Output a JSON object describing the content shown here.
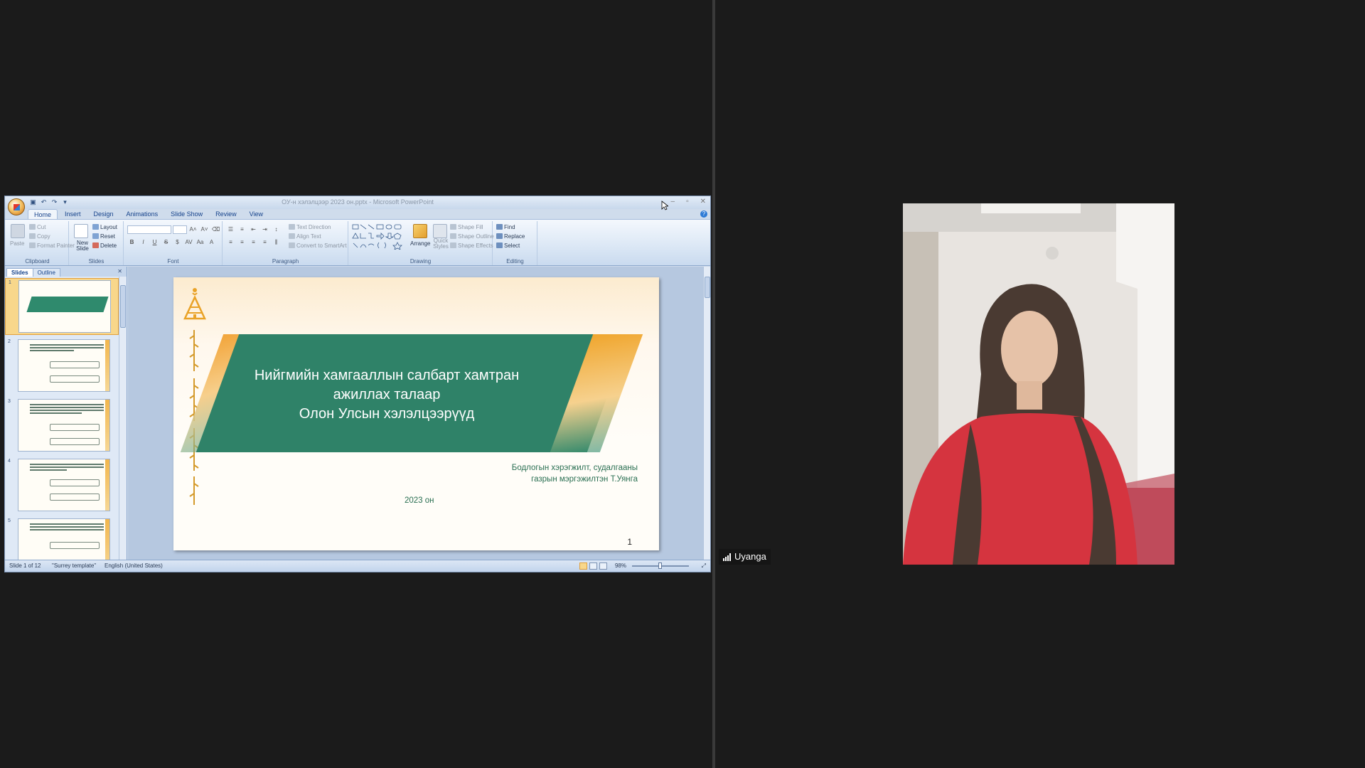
{
  "window": {
    "title": "ОУ-н хэлэлцээр 2023 он.pptx - Microsoft PowerPoint"
  },
  "ribbon": {
    "tabs": [
      "Home",
      "Insert",
      "Design",
      "Animations",
      "Slide Show",
      "Review",
      "View"
    ],
    "clipboard": {
      "paste": "Paste",
      "cut": "Cut",
      "copy": "Copy",
      "format_painter": "Format Painter",
      "label": "Clipboard"
    },
    "slides_group": {
      "new_slide": "New Slide",
      "layout": "Layout",
      "reset": "Reset",
      "delete": "Delete",
      "label": "Slides"
    },
    "font_group": {
      "label": "Font"
    },
    "paragraph_group": {
      "text_direction": "Text Direction",
      "align_text": "Align Text",
      "convert_smartart": "Convert to SmartArt",
      "label": "Paragraph"
    },
    "drawing_group": {
      "arrange": "Arrange",
      "quick_styles": "Quick Styles",
      "shape_fill": "Shape Fill",
      "shape_outline": "Shape Outline",
      "shape_effects": "Shape Effects",
      "label": "Drawing"
    },
    "editing_group": {
      "find": "Find",
      "replace": "Replace",
      "select": "Select",
      "label": "Editing"
    }
  },
  "slides_panel": {
    "tabs": [
      "Slides",
      "Outline"
    ],
    "thumb_numbers": [
      "1",
      "2",
      "3",
      "4",
      "5"
    ]
  },
  "slide": {
    "title_line1": "Нийгмийн хамгааллын салбарт хамтран",
    "title_line2": "ажиллах талаар",
    "title_line3": "Олон Улсын хэлэлцээрүүд",
    "subtitle_line1": "Бодлогын хэрэгжилт, судалгааны",
    "subtitle_line2": "газрын мэргэжилтэн Т.Уянга",
    "year": "2023 он",
    "page_number": "1"
  },
  "status": {
    "slide_of": "Slide 1 of 12",
    "template": "\"Surrey template\"",
    "language": "English (United States)",
    "zoom": "98%"
  },
  "participant": {
    "name": "Uyanga"
  },
  "colors": {
    "band_green": "#2f8268",
    "accent_gold": "#f0a62e",
    "text_green": "#2a6f52"
  }
}
